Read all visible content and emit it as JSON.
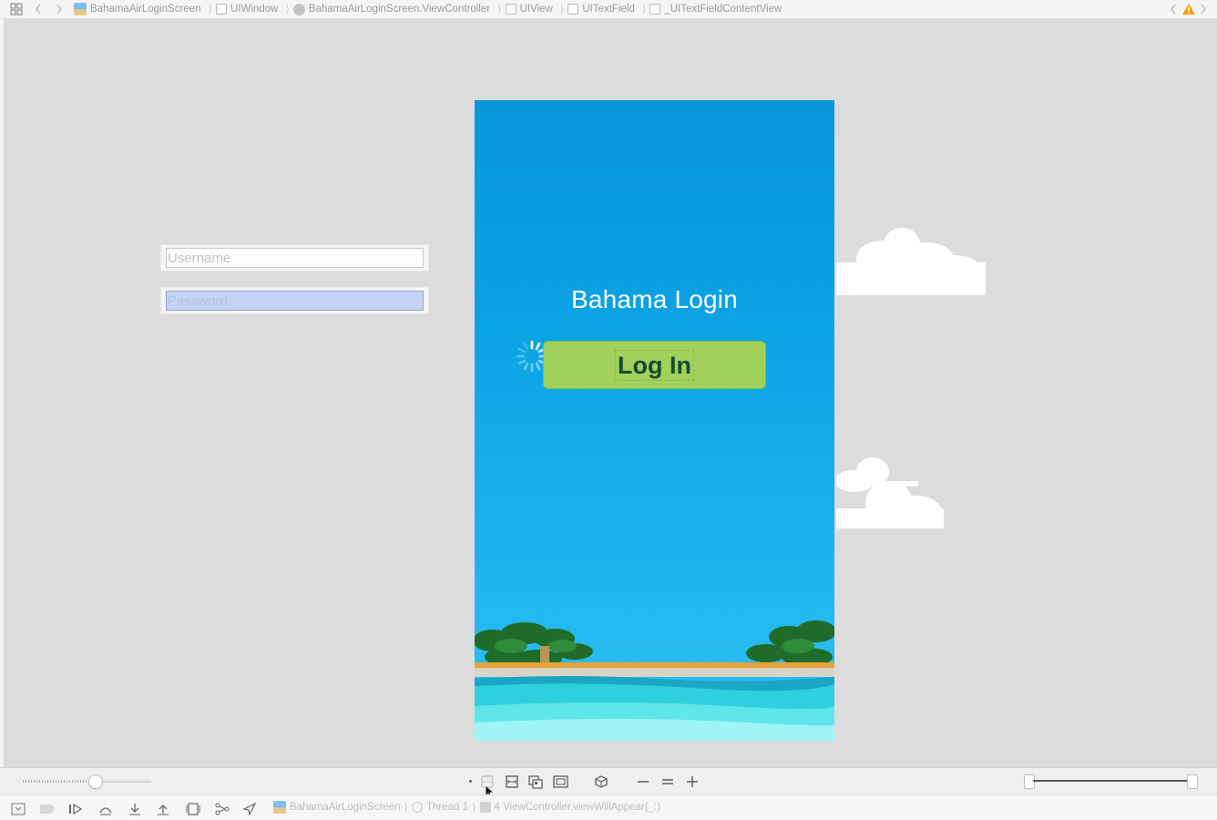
{
  "jumpbar": {
    "crumbs": [
      "BahamaAirLoginScreen",
      "UIWindow",
      "BahamaAirLoginScreen.ViewController",
      "UIView",
      "UITextField",
      "_UITextFieldContentView"
    ]
  },
  "canvas": {
    "username_placeholder": "Username",
    "password_placeholder": "Password"
  },
  "app": {
    "title": "Bahama Login",
    "login_button": "Log In",
    "sky_color": "#0a9fe0",
    "button_color": "#a1d15a"
  },
  "debugbar": {
    "breadcrumbs": [
      "BahamaAirLoginScreen",
      "Thread 1",
      "4 ViewController.viewWillAppear(_:)"
    ]
  },
  "icons": {
    "warning_color": "#f0a30a"
  }
}
